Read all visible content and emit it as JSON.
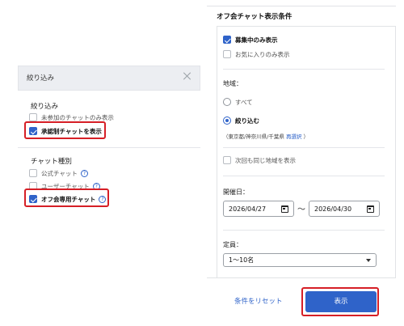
{
  "left_panel": {
    "title": "絞り込み",
    "sections": [
      {
        "title": "絞り込み",
        "options": [
          {
            "label": "未参加のチャットのみ表示",
            "checked": false
          },
          {
            "label": "承認制チャットを表示",
            "checked": true
          }
        ]
      },
      {
        "title": "チャット種別",
        "options": [
          {
            "label": "公式チャット",
            "checked": false,
            "help": "?"
          },
          {
            "label": "ユーザーチャット",
            "checked": false,
            "help": "?"
          },
          {
            "label": "オフ会専用チャット",
            "checked": true,
            "help": "?"
          }
        ]
      }
    ]
  },
  "right_panel": {
    "title": "オフ会チャット表示条件",
    "options": [
      {
        "label": "募集中のみ表示",
        "checked": true
      },
      {
        "label": "お気に入りのみ表示",
        "checked": false
      }
    ],
    "area": {
      "label": "地域：",
      "radios": [
        {
          "label": "すべて",
          "selected": false
        },
        {
          "label": "絞り込む",
          "selected": true
        }
      ],
      "selected_regions": "（東京都/神奈川県/千葉県",
      "reselect_link": "再選択",
      "closing_paren": "）",
      "same_next_time": {
        "label": "次回も同じ地域を表示",
        "checked": false
      }
    },
    "dates": {
      "label": "開催日：",
      "from": "2026/04/27",
      "separator": "〜",
      "to": "2026/04/30"
    },
    "capacity": {
      "label": "定員：",
      "value": "1〜10名"
    },
    "footer": {
      "reset_label": "条件をリセット",
      "show_label": "表示"
    }
  },
  "colors": {
    "accent": "#2f63c9",
    "highlight": "#d61f26",
    "header_bg": "#eceef2"
  }
}
